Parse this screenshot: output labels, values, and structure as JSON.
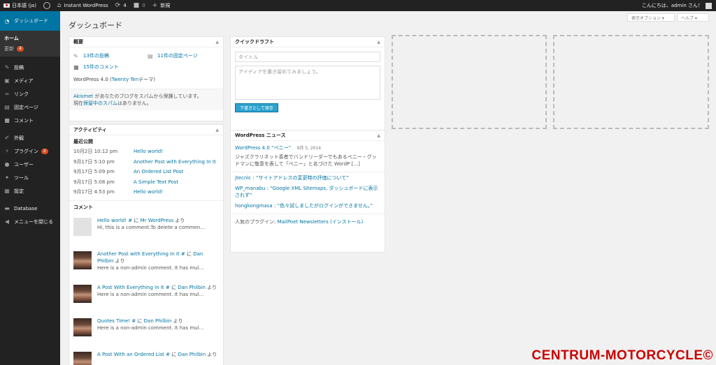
{
  "adminbar": {
    "language": "日本語 (ja)",
    "site_name": "Instant WordPress",
    "updates_count": "4",
    "comments_count": "0",
    "new_label": "新規",
    "greeting": "こんにちは、admin さん！"
  },
  "sidebar": {
    "dashboard": "ダッシュボード",
    "home": "ホーム",
    "updates": "更新",
    "updates_badge": "4",
    "items": [
      {
        "label": "投稿",
        "icon": "pushpin-icon"
      },
      {
        "label": "メディア",
        "icon": "media-icon"
      },
      {
        "label": "リンク",
        "icon": "link-icon"
      },
      {
        "label": "固定ページ",
        "icon": "page-icon"
      },
      {
        "label": "コメント",
        "icon": "comment-icon"
      }
    ],
    "items2": [
      {
        "label": "外観",
        "icon": "appearance-icon"
      },
      {
        "label": "プラグイン",
        "icon": "plugin-icon",
        "badge": "2"
      },
      {
        "label": "ユーザー",
        "icon": "user-icon"
      },
      {
        "label": "ツール",
        "icon": "tools-icon"
      },
      {
        "label": "設定",
        "icon": "settings-icon"
      }
    ],
    "database": "Database",
    "collapse": "メニューを閉じる"
  },
  "main": {
    "title": "ダッシュボード",
    "screen_options": "表示オプション ▾",
    "help": "ヘルプ ▾"
  },
  "glance": {
    "title": "概要",
    "posts": "13件の投稿",
    "pages": "11件の固定ページ",
    "comments": "15件のコメント",
    "version_prefix": "WordPress 4.0 (",
    "theme": "Twenty Ten",
    "version_suffix": " テーマ)",
    "akismet_link": "Akismet",
    "akismet_text": " があなたのブログをスパムから保護しています。",
    "spam_prefix": "現在",
    "spam_link": "保留中のスパム",
    "spam_suffix": "はありません。"
  },
  "activity": {
    "title": "アクティビティ",
    "recent_title": "最近公開",
    "posts": [
      {
        "date": "10月2日 10:12 pm",
        "title": "Hello world!"
      },
      {
        "date": "9月17日 5:10 pm",
        "title": "Another Post with Everything In It"
      },
      {
        "date": "9月17日 5:09 pm",
        "title": "An Ordered List Post"
      },
      {
        "date": "9月17日 5:08 pm",
        "title": "A Simple Text Post"
      },
      {
        "date": "9月17日 4:53 pm",
        "title": "Hello world!"
      }
    ],
    "comments_title": "コメント",
    "comments": [
      {
        "post": "Hello world! #",
        "by": " に ",
        "author": "Mr WordPress",
        "tail": " より",
        "text": "Hi, this is a comment.To delete a commen…"
      },
      {
        "post": "Another Post with Everything In It #",
        "by": " に ",
        "author": "Dan Philbin",
        "tail": " より",
        "text": "Here is a non-admin comment. It has mul…"
      },
      {
        "post": "A Post With Everything In It #",
        "by": " に ",
        "author": "Dan Philbin",
        "tail": " より",
        "text": "Here is a non-admin comment. It has mul…"
      },
      {
        "post": "Quotes Time! #",
        "by": " に ",
        "author": "Dan Philbin",
        "tail": " より",
        "text": "Here is a non-admin comment. It has mul…"
      },
      {
        "post": "A Post With an Ordered List #",
        "by": " に ",
        "author": "Dan Philbin",
        "tail": " より",
        "text": ""
      }
    ]
  },
  "quickdraft": {
    "title": "クイックドラフト",
    "title_placeholder": "タイトル",
    "content_placeholder": "アイディアを書き留めてみましょう。",
    "save_label": "下書きとして保存"
  },
  "news": {
    "title": "WordPress ニュース",
    "headline": "WordPress 4.0 “ベニー”",
    "headline_date": "9月 5, 2014",
    "excerpt": "ジャズクラリネット奏者でバンドリーダーでもあるベニー・グッドマンに敬意を表して「ベニー」と名づけた WordP […]",
    "links": [
      {
        "author": "jtecnlc",
        "sep": " : ",
        "title": "“サイトアドレスの変更時の評価について”"
      },
      {
        "author": "WP_manabu",
        "sep": " : ",
        "title": "“Google XML Sitemaps, ダッシュボードに表示されず”"
      },
      {
        "author": "hongkongmasa",
        "sep": " : ",
        "title": "“色々試しましたがログインができません。”"
      }
    ],
    "plugin_prefix": "人気のプラグイン: ",
    "plugin_name": "MailPoet Newsletters",
    "plugin_install": " (インストール)"
  },
  "watermark": "CENTRUM-MOTORCYCLE©",
  "colors": {
    "accent": "#0074a2",
    "button": "#2ea2cc",
    "badge": "#d54e21",
    "watermark": "#cc0000"
  }
}
